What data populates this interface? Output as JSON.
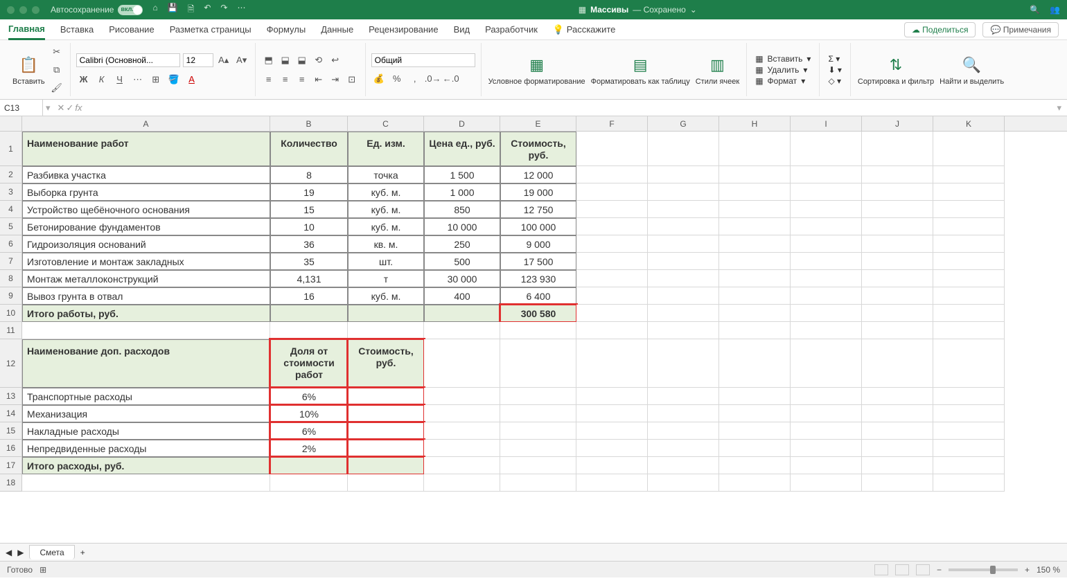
{
  "title": {
    "autosave": "Автосохранение",
    "autosave_state": "вкл.",
    "docname": "Массивы",
    "saved": "— Сохранено"
  },
  "tabs": {
    "home": "Главная",
    "insert": "Вставка",
    "draw": "Рисование",
    "layout": "Разметка страницы",
    "formulas": "Формулы",
    "data": "Данные",
    "review": "Рецензирование",
    "view": "Вид",
    "developer": "Разработчик",
    "tell": "Расскажите",
    "share": "Поделиться",
    "comments": "Примечания"
  },
  "ribbon": {
    "paste": "Вставить",
    "font": "Calibri (Основной...",
    "size": "12",
    "numfmt": "Общий",
    "condfmt": "Условное форматирование",
    "fmttable": "Форматировать как таблицу",
    "cellstyles": "Стили ячеек",
    "insert_cells": "Вставить",
    "delete_cells": "Удалить",
    "format_cells": "Формат",
    "sort": "Сортировка и фильтр",
    "find": "Найти и выделить"
  },
  "namebox": "C13",
  "columns": [
    "A",
    "B",
    "C",
    "D",
    "E",
    "F",
    "G",
    "H",
    "I",
    "J",
    "K"
  ],
  "row_numbers": [
    1,
    2,
    3,
    4,
    5,
    6,
    7,
    8,
    9,
    10,
    11,
    12,
    13,
    14,
    15,
    16,
    17,
    18
  ],
  "table1": {
    "headers": {
      "name": "Наименование работ",
      "qty": "Количество",
      "unit": "Ед. изм.",
      "price": "Цена ед., руб.",
      "cost": "Стоимость, руб."
    },
    "rows": [
      {
        "name": "Разбивка участка",
        "qty": "8",
        "unit": "точка",
        "price": "1 500",
        "cost": "12 000"
      },
      {
        "name": "Выборка грунта",
        "qty": "19",
        "unit": "куб. м.",
        "price": "1 000",
        "cost": "19 000"
      },
      {
        "name": "Устройство щебёночного основания",
        "qty": "15",
        "unit": "куб. м.",
        "price": "850",
        "cost": "12 750"
      },
      {
        "name": "Бетонирование фундаментов",
        "qty": "10",
        "unit": "куб. м.",
        "price": "10 000",
        "cost": "100 000"
      },
      {
        "name": "Гидроизоляция оснований",
        "qty": "36",
        "unit": "кв. м.",
        "price": "250",
        "cost": "9 000"
      },
      {
        "name": "Изготовление и монтаж закладных",
        "qty": "35",
        "unit": "шт.",
        "price": "500",
        "cost": "17 500"
      },
      {
        "name": "Монтаж металлоконструкций",
        "qty": "4,131",
        "unit": "т",
        "price": "30 000",
        "cost": "123 930"
      },
      {
        "name": "Вывоз грунта в отвал",
        "qty": "16",
        "unit": "куб. м.",
        "price": "400",
        "cost": "6 400"
      }
    ],
    "total_label": "Итого работы, руб.",
    "total_value": "300 580"
  },
  "table2": {
    "headers": {
      "name": "Наименование доп. расходов",
      "share": "Доля от стоимости работ",
      "cost": "Стоимость, руб."
    },
    "rows": [
      {
        "name": "Транспортные расходы",
        "share": "6%",
        "cost": ""
      },
      {
        "name": "Механизация",
        "share": "10%",
        "cost": ""
      },
      {
        "name": "Накладные расходы",
        "share": "6%",
        "cost": ""
      },
      {
        "name": "Непредвиденные расходы",
        "share": "2%",
        "cost": ""
      }
    ],
    "total_label": "Итого расходы, руб."
  },
  "sheet": "Смета",
  "status": {
    "ready": "Готово",
    "zoom": "150 %"
  }
}
